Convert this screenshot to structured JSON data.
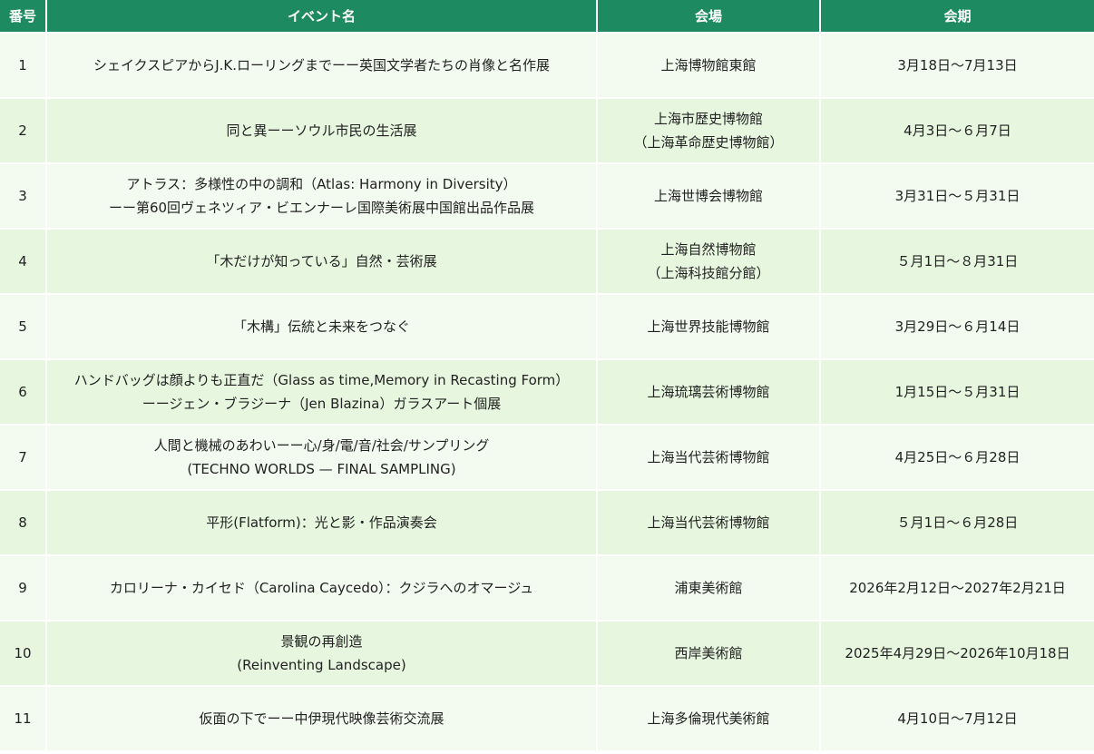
{
  "header": {
    "number": "番号",
    "event_name": "イベント名",
    "venue": "会場",
    "period": "会期"
  },
  "rows": [
    {
      "number": "1",
      "event": [
        "シェイクスピアからJ.K.ローリングまでーー英国文学者たちの肖像と名作展"
      ],
      "venue": [
        "上海博物館東館"
      ],
      "period": "3月18日～7月13日"
    },
    {
      "number": "2",
      "event": [
        "同と異ーーソウル市民の生活展"
      ],
      "venue": [
        "上海市歴史博物館",
        "（上海革命歴史博物館）"
      ],
      "period": "4月3日～６月7日"
    },
    {
      "number": "3",
      "event": [
        "アトラス：多様性の中の調和（Atlas: Harmony in Diversity）",
        "ーー第60回ヴェネツィア・ビエンナーレ国際美術展中国館出品作品展"
      ],
      "venue": [
        "上海世博会博物館"
      ],
      "period": "3月31日～５月31日"
    },
    {
      "number": "4",
      "event": [
        "「木だけが知っている」自然・芸術展"
      ],
      "venue": [
        "上海自然博物館",
        "（上海科技館分館）"
      ],
      "period": "５月1日～８月31日"
    },
    {
      "number": "5",
      "event": [
        "「木構」伝統と未来をつなぐ"
      ],
      "venue": [
        "上海世界技能博物館"
      ],
      "period": "3月29日～６月14日"
    },
    {
      "number": "6",
      "event": [
        "ハンドバッグは顔よりも正直だ（Glass as time,Memory in Recasting Form）",
        "ーージェン・ブラジーナ（Jen Blazina）ガラスアート個展"
      ],
      "venue": [
        "上海琉璃芸術博物館"
      ],
      "period": "1月15日～５月31日"
    },
    {
      "number": "7",
      "event": [
        "人間と機械のあわいーー心/身/電/音/社会/サンプリング",
        "(TECHNO WORLDS — FINAL SAMPLING)"
      ],
      "venue": [
        "上海当代芸術博物館"
      ],
      "period": "4月25日～６月28日"
    },
    {
      "number": "8",
      "event": [
        "平形(Flatform)：光と影・作品演奏会"
      ],
      "venue": [
        "上海当代芸術博物館"
      ],
      "period": "５月1日～６月28日"
    },
    {
      "number": "9",
      "event": [
        "カロリーナ・カイセド（Carolina Caycedo）：クジラへのオマージュ"
      ],
      "venue": [
        "浦東美術館"
      ],
      "period": "2026年2月12日～2027年2月21日"
    },
    {
      "number": "10",
      "event": [
        "景観の再創造",
        "(Reinventing Landscape)"
      ],
      "venue": [
        "西岸美術館"
      ],
      "period": "2025年4月29日～2026年10月18日"
    },
    {
      "number": "11",
      "event": [
        "仮面の下でーー中伊現代映像芸術交流展"
      ],
      "venue": [
        "上海多倫現代美術館"
      ],
      "period": "4月10日～7月12日"
    }
  ],
  "colors": {
    "header_bg": "#1e8a61",
    "header_text": "#ffffff",
    "row_odd_bg": "#f3faef",
    "row_even_bg": "#e6f6df"
  }
}
